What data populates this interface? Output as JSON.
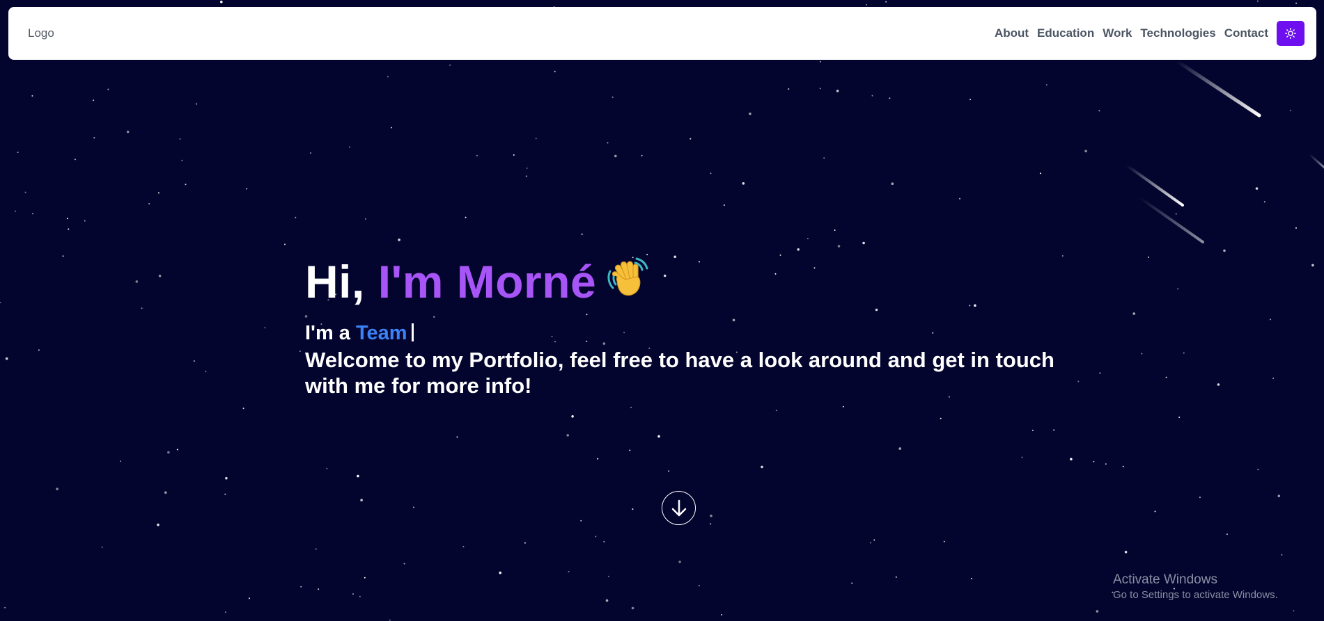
{
  "navbar": {
    "logo": "Logo",
    "links": [
      "About",
      "Education",
      "Work",
      "Technologies",
      "Contact"
    ],
    "theme_toggle_icon": "sun-icon",
    "accent": "#6d0fef"
  },
  "hero": {
    "greeting": "Hi, ",
    "name": "I'm Morné",
    "wave_icon": "waving-hand-icon",
    "typed_prefix": "I'm a ",
    "typed_word": "Team",
    "welcome": "Welcome to my Portfolio, feel free to have a look around and get in touch with me for more info!",
    "name_color": "#a855f7",
    "typed_color": "#3b82f6"
  },
  "scroll_down_icon": "arrow-down-circle-icon",
  "windows_watermark": {
    "title": "Activate Windows",
    "subtitle": "Go to Settings to activate Windows."
  },
  "background_color": "#04052e"
}
